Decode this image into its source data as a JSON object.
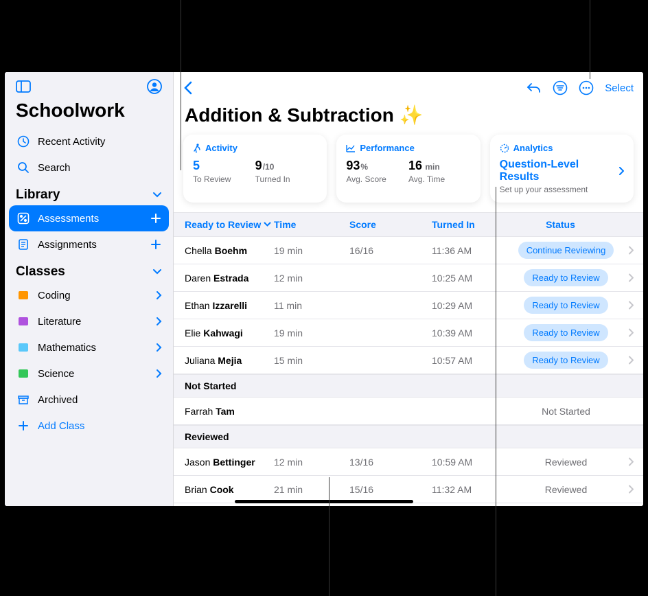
{
  "sidebar": {
    "app_title": "Schoolwork",
    "recent": "Recent Activity",
    "search": "Search",
    "library_heading": "Library",
    "assessments": "Assessments",
    "assignments": "Assignments",
    "classes_heading": "Classes",
    "classes": [
      "Coding",
      "Literature",
      "Mathematics",
      "Science"
    ],
    "archived": "Archived",
    "add_class": "Add Class"
  },
  "main": {
    "title": "Addition & Subtraction ✨",
    "select": "Select",
    "cards": {
      "activity": {
        "heading": "Activity",
        "review_val": "5",
        "review_lbl": "To Review",
        "turned_val": "9",
        "turned_total": "/10",
        "turned_lbl": "Turned In"
      },
      "performance": {
        "heading": "Performance",
        "score_val": "93",
        "score_unit": "%",
        "score_lbl": "Avg. Score",
        "time_val": "16",
        "time_unit": " min",
        "time_lbl": "Avg. Time"
      },
      "analytics": {
        "heading": "Analytics",
        "title": "Question-Level Results",
        "sub": "Set up your assessment"
      }
    },
    "columns": {
      "ready": "Ready to Review",
      "time": "Time",
      "score": "Score",
      "turned": "Turned In",
      "status": "Status"
    },
    "rows": [
      {
        "first": "Chella",
        "last": "Boehm",
        "time": "19 min",
        "score": "16/16",
        "turned": "11:36 AM",
        "status": "Continue Reviewing",
        "pill": true,
        "chev": true
      },
      {
        "first": "Daren",
        "last": "Estrada",
        "time": "12 min",
        "score": "",
        "turned": "10:25 AM",
        "status": "Ready to Review",
        "pill": true,
        "chev": true
      },
      {
        "first": "Ethan",
        "last": "Izzarelli",
        "time": "11 min",
        "score": "",
        "turned": "10:29 AM",
        "status": "Ready to Review",
        "pill": true,
        "chev": true
      },
      {
        "first": "Elie",
        "last": "Kahwagi",
        "time": "19 min",
        "score": "",
        "turned": "10:39 AM",
        "status": "Ready to Review",
        "pill": true,
        "chev": true
      },
      {
        "first": "Juliana",
        "last": "Mejia",
        "time": "15 min",
        "score": "",
        "turned": "10:57 AM",
        "status": "Ready to Review",
        "pill": true,
        "chev": true
      }
    ],
    "not_started_heading": "Not Started",
    "not_started_rows": [
      {
        "first": "Farrah",
        "last": "Tam",
        "time": "",
        "score": "",
        "turned": "",
        "status": "Not Started",
        "pill": false,
        "chev": false
      }
    ],
    "reviewed_heading": "Reviewed",
    "reviewed_rows": [
      {
        "first": "Jason",
        "last": "Bettinger",
        "time": "12 min",
        "score": "13/16",
        "turned": "10:59 AM",
        "status": "Reviewed",
        "pill": false,
        "chev": true
      },
      {
        "first": "Brian",
        "last": "Cook",
        "time": "21 min",
        "score": "15/16",
        "turned": "11:32 AM",
        "status": "Reviewed",
        "pill": false,
        "chev": true
      }
    ]
  }
}
